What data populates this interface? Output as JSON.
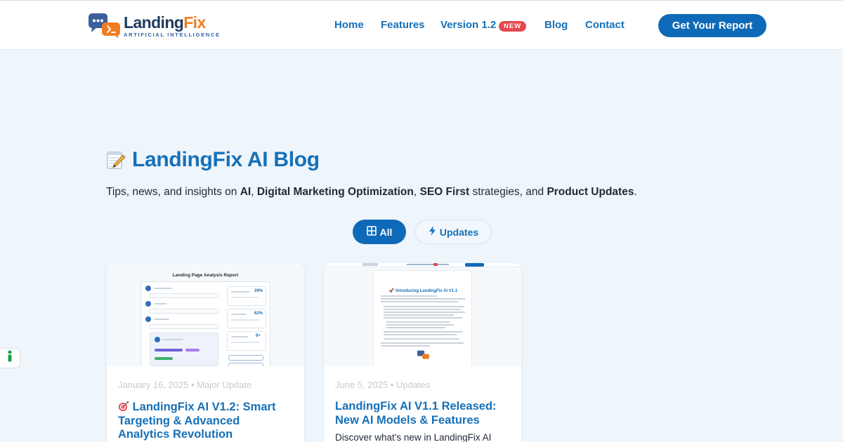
{
  "brand": {
    "name_part1": "Landing",
    "name_part2": "Fix",
    "tagline": "ARTIFICIAL INTELLIGENCE"
  },
  "nav": {
    "home": "Home",
    "features": "Features",
    "version": "Version 1.2",
    "version_badge": "NEW",
    "blog": "Blog",
    "contact": "Contact",
    "cta": "Get Your Report"
  },
  "hero": {
    "icon": "memo-icon",
    "title": "LandingFix AI Blog",
    "subtitle_parts": [
      "Tips, news, and insights on ",
      "AI",
      ", ",
      "Digital Marketing Optimization",
      ", ",
      "SEO First",
      " strategies, and ",
      "Product Updates",
      "."
    ]
  },
  "filters": {
    "all_label": "All",
    "updates_label": "Updates",
    "selected": "All"
  },
  "posts": [
    {
      "thumb_title": "Landing Page Analysis Report",
      "date": "January 16, 2025",
      "category": "Major Update",
      "title_icon": "target-icon",
      "title": "LandingFix AI V1.2: Smart Targeting & Advanced Analytics Revolution",
      "thumb_stats": [
        "29%",
        "62%",
        "9+"
      ]
    },
    {
      "thumb_heading": "🚀 Introducing LandingFix AI V1.1",
      "date": "June 5, 2025",
      "category": "Updates",
      "title": "LandingFix AI V1.1 Released: New AI Models & Features",
      "excerpt": "Discover what's new in LandingFix AI"
    }
  ],
  "colors": {
    "primary": "#1670b8",
    "button": "#0e6ab8",
    "background": "#eef5fb",
    "badge": "#e5484d",
    "brand_orange": "#ef7d22",
    "brand_navy": "#1e3a5f"
  }
}
